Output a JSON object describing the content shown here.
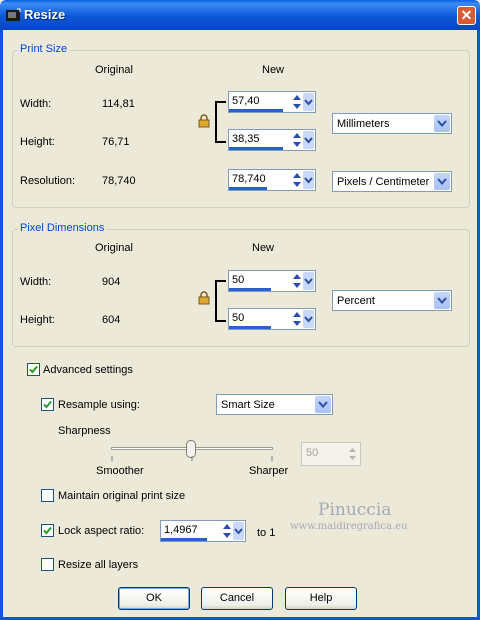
{
  "window": {
    "title": "Resize",
    "close_symbol": "✕"
  },
  "print_size": {
    "legend": "Print Size",
    "col_original": "Original",
    "col_new": "New",
    "width_label": "Width:",
    "width_original": "114,81",
    "width_new": "57,40",
    "height_label": "Height:",
    "height_original": "76,71",
    "height_new": "38,35",
    "units": "Millimeters",
    "resolution_label": "Resolution:",
    "resolution_original": "78,740",
    "resolution_new": "78,740",
    "resolution_units": "Pixels / Centimeter"
  },
  "pixel_dimensions": {
    "legend": "Pixel Dimensions",
    "col_original": "Original",
    "col_new": "New",
    "width_label": "Width:",
    "width_original": "904",
    "width_new": "50",
    "height_label": "Height:",
    "height_original": "604",
    "height_new": "50",
    "units": "Percent"
  },
  "advanced": {
    "advanced_settings_label": "Advanced settings",
    "advanced_settings_checked": true,
    "resample_label": "Resample using:",
    "resample_checked": true,
    "resample_method": "Smart Size",
    "sharpness_label": "Sharpness",
    "smoother_label": "Smoother",
    "sharper_label": "Sharper",
    "sharpness_value": "50",
    "sharpness_level": 0.5,
    "maintain_print_size_label": "Maintain original print size",
    "maintain_print_size_checked": false,
    "lock_aspect_label": "Lock aspect ratio:",
    "lock_aspect_checked": true,
    "aspect_value": "1,4967",
    "aspect_suffix": "to 1",
    "resize_all_layers_label": "Resize all layers",
    "resize_all_layers_checked": false
  },
  "watermark": {
    "name": "Pinuccia",
    "url": "www.maidiregrafica.eu"
  },
  "buttons": {
    "ok": "OK",
    "cancel": "Cancel",
    "help": "Help"
  },
  "colors": {
    "titlebar": "#0b57d8",
    "legend_text": "#0046d5",
    "dialog_bg": "#ece9d8",
    "spin_fill": "#2a5fd1"
  }
}
